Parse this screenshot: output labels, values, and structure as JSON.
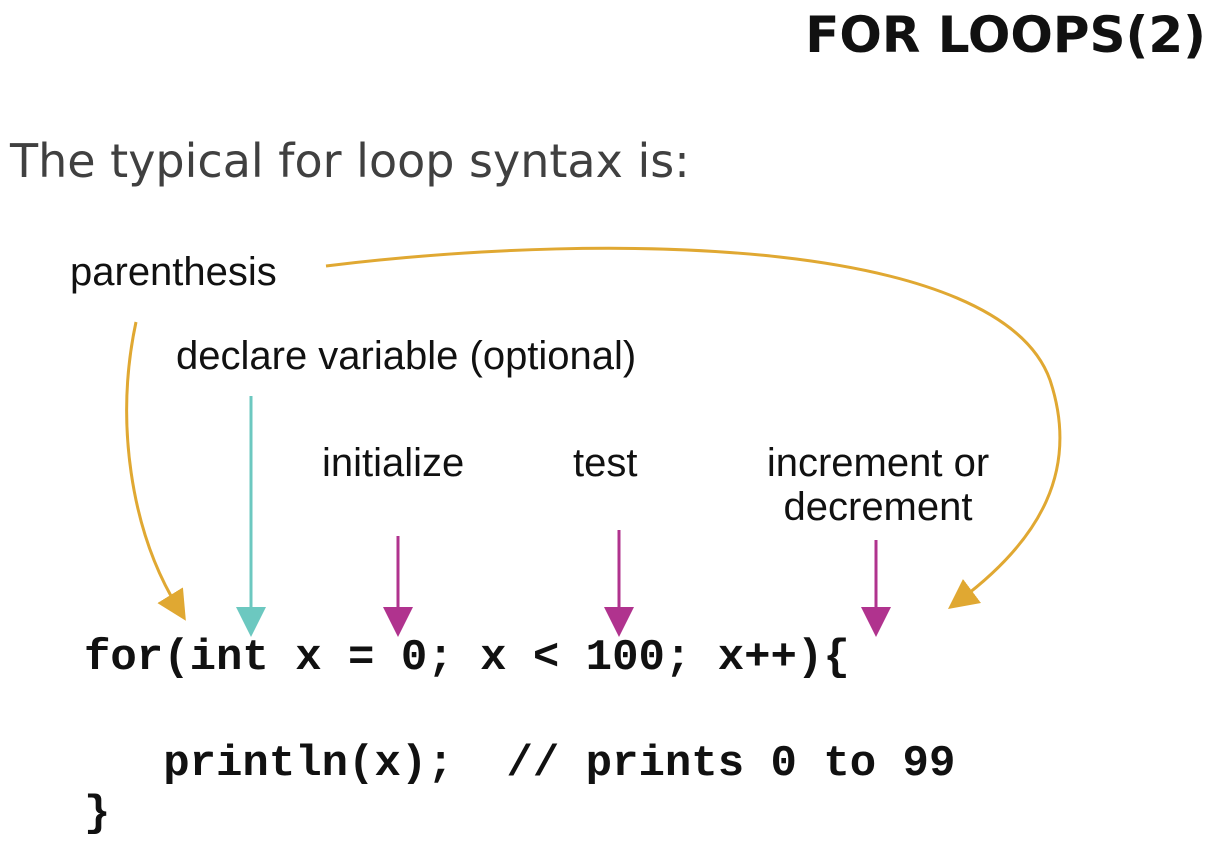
{
  "title": "FOR LOOPS(2)",
  "subtitle": "The typical for loop syntax is:",
  "labels": {
    "parenthesis": "parenthesis",
    "declare": "declare variable (optional)",
    "initialize": "initialize",
    "test": "test",
    "increment_line1": "increment or",
    "increment_line2": "decrement"
  },
  "code": {
    "line1": "for(int x = 0; x < 100; x++){",
    "line2": "   println(x);  // prints 0 to 99",
    "line3": "}"
  },
  "colors": {
    "paren_arrow": "#E0A832",
    "declare_arrow": "#6CC8C0",
    "part_arrow": "#B0338E"
  }
}
